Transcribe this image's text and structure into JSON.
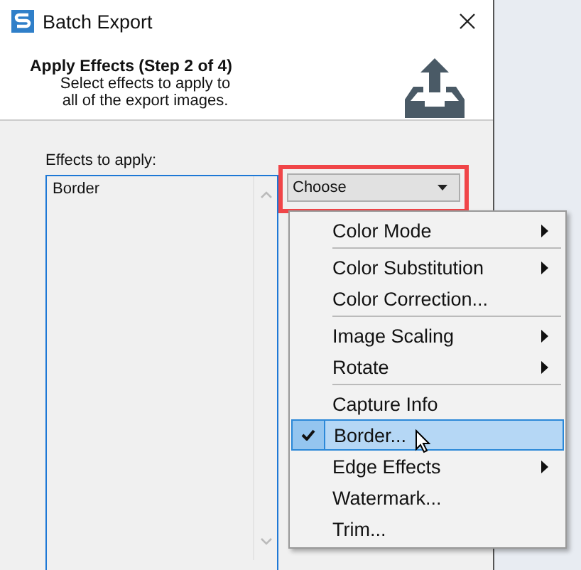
{
  "window": {
    "title": "Batch Export"
  },
  "header": {
    "title": "Apply Effects (Step 2 of 4)",
    "subtitle": "Select effects to apply to\nall of the export images."
  },
  "effects_label": "Effects to apply:",
  "effects_list": {
    "items": [
      "Border"
    ]
  },
  "dropdown": {
    "value": "Choose",
    "annotated": true
  },
  "menu": [
    {
      "label": "Color Mode",
      "submenu": true,
      "checked": false,
      "selected": false,
      "separator_after": true
    },
    {
      "label": "Color Substitution",
      "submenu": true,
      "checked": false,
      "selected": false,
      "separator_after": false
    },
    {
      "label": "Color Correction...",
      "submenu": false,
      "checked": false,
      "selected": false,
      "separator_after": true
    },
    {
      "label": "Image Scaling",
      "submenu": true,
      "checked": false,
      "selected": false,
      "separator_after": false
    },
    {
      "label": "Rotate",
      "submenu": true,
      "checked": false,
      "selected": false,
      "separator_after": true
    },
    {
      "label": "Capture Info",
      "submenu": false,
      "checked": false,
      "selected": false,
      "separator_after": false
    },
    {
      "label": "Border...",
      "submenu": false,
      "checked": true,
      "selected": true,
      "separator_after": false
    },
    {
      "label": "Edge Effects",
      "submenu": true,
      "checked": false,
      "selected": false,
      "separator_after": false
    },
    {
      "label": "Watermark...",
      "submenu": false,
      "checked": false,
      "selected": false,
      "separator_after": false
    },
    {
      "label": "Trim...",
      "submenu": false,
      "checked": false,
      "selected": false,
      "separator_after": false
    }
  ]
}
